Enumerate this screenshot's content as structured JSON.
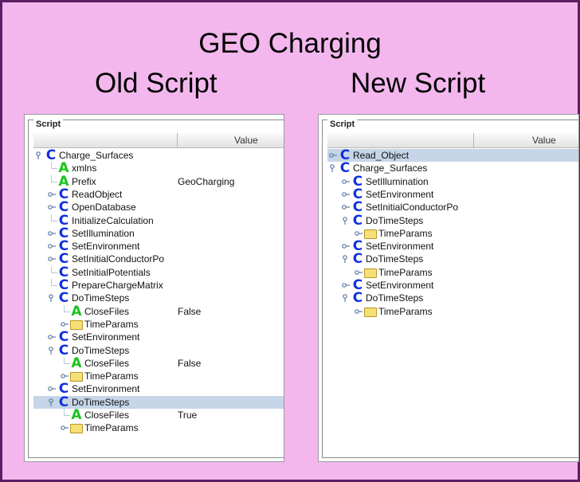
{
  "slide": {
    "title": "GEO Charging",
    "left_heading": "Old Script",
    "right_heading": "New Script"
  },
  "colors": {
    "slide_background": "#f3b7ee",
    "slide_border": "#5a1f63",
    "class_icon": "#1131e0",
    "attribute_icon": "#18c51a",
    "selected_row": "#c6d6e8"
  },
  "old_script": {
    "frame_label": "Script",
    "value_header": "Value",
    "rows": [
      {
        "level": 0,
        "toggle": "expanded",
        "icon": "class-icon",
        "label": "Charge_Surfaces",
        "value": ""
      },
      {
        "level": 1,
        "toggle": "none",
        "icon": "attribute-icon",
        "label": "xmlns",
        "value": ""
      },
      {
        "level": 1,
        "toggle": "none",
        "icon": "attribute-icon",
        "label": "Prefix",
        "value": "GeoCharging"
      },
      {
        "level": 1,
        "toggle": "collapsed",
        "icon": "class-icon",
        "label": "ReadObject",
        "value": ""
      },
      {
        "level": 1,
        "toggle": "collapsed",
        "icon": "class-icon",
        "label": "OpenDatabase",
        "value": ""
      },
      {
        "level": 1,
        "toggle": "none",
        "icon": "class-icon",
        "label": "InitializeCalculation",
        "value": ""
      },
      {
        "level": 1,
        "toggle": "collapsed",
        "icon": "class-icon",
        "label": "SetIllumination",
        "value": ""
      },
      {
        "level": 1,
        "toggle": "collapsed",
        "icon": "class-icon",
        "label": "SetEnvironment",
        "value": ""
      },
      {
        "level": 1,
        "toggle": "collapsed",
        "icon": "class-icon",
        "label": "SetInitialConductorPo",
        "value": ""
      },
      {
        "level": 1,
        "toggle": "none",
        "icon": "class-icon",
        "label": "SetInitialPotentials",
        "value": ""
      },
      {
        "level": 1,
        "toggle": "none",
        "icon": "class-icon",
        "label": "PrepareChargeMatrix",
        "value": ""
      },
      {
        "level": 1,
        "toggle": "expanded",
        "icon": "class-icon",
        "label": "DoTimeSteps",
        "value": ""
      },
      {
        "level": 2,
        "toggle": "none",
        "icon": "attribute-icon",
        "label": "CloseFiles",
        "value": "False"
      },
      {
        "level": 2,
        "toggle": "collapsed",
        "icon": "folder-icon",
        "label": "TimeParams",
        "value": ""
      },
      {
        "level": 1,
        "toggle": "collapsed",
        "icon": "class-icon",
        "label": "SetEnvironment",
        "value": ""
      },
      {
        "level": 1,
        "toggle": "expanded",
        "icon": "class-icon",
        "label": "DoTimeSteps",
        "value": ""
      },
      {
        "level": 2,
        "toggle": "none",
        "icon": "attribute-icon",
        "label": "CloseFiles",
        "value": "False"
      },
      {
        "level": 2,
        "toggle": "collapsed",
        "icon": "folder-icon",
        "label": "TimeParams",
        "value": ""
      },
      {
        "level": 1,
        "toggle": "collapsed",
        "icon": "class-icon",
        "label": "SetEnvironment",
        "value": ""
      },
      {
        "level": 1,
        "toggle": "expanded",
        "icon": "class-icon",
        "label": "DoTimeSteps",
        "value": "",
        "selected": true
      },
      {
        "level": 2,
        "toggle": "none",
        "icon": "attribute-icon",
        "label": "CloseFiles",
        "value": "True"
      },
      {
        "level": 2,
        "toggle": "collapsed",
        "icon": "folder-icon",
        "label": "TimeParams",
        "value": ""
      }
    ]
  },
  "new_script": {
    "frame_label": "Script",
    "value_header": "Value",
    "rows": [
      {
        "level": 0,
        "toggle": "collapsed",
        "icon": "class-icon",
        "label": "Read_Object",
        "value": "",
        "selected": true
      },
      {
        "level": 0,
        "toggle": "expanded",
        "icon": "class-icon",
        "label": "Charge_Surfaces",
        "value": ""
      },
      {
        "level": 1,
        "toggle": "collapsed",
        "icon": "class-icon",
        "label": "SetIllumination",
        "value": ""
      },
      {
        "level": 1,
        "toggle": "collapsed",
        "icon": "class-icon",
        "label": "SetEnvironment",
        "value": ""
      },
      {
        "level": 1,
        "toggle": "collapsed",
        "icon": "class-icon",
        "label": "SetInitialConductorPo",
        "value": ""
      },
      {
        "level": 1,
        "toggle": "expanded",
        "icon": "class-icon",
        "label": "DoTimeSteps",
        "value": ""
      },
      {
        "level": 2,
        "toggle": "collapsed",
        "icon": "folder-icon",
        "label": "TimeParams",
        "value": ""
      },
      {
        "level": 1,
        "toggle": "collapsed",
        "icon": "class-icon",
        "label": "SetEnvironment",
        "value": ""
      },
      {
        "level": 1,
        "toggle": "expanded",
        "icon": "class-icon",
        "label": "DoTimeSteps",
        "value": ""
      },
      {
        "level": 2,
        "toggle": "collapsed",
        "icon": "folder-icon",
        "label": "TimeParams",
        "value": ""
      },
      {
        "level": 1,
        "toggle": "collapsed",
        "icon": "class-icon",
        "label": "SetEnvironment",
        "value": ""
      },
      {
        "level": 1,
        "toggle": "expanded",
        "icon": "class-icon",
        "label": "DoTimeSteps",
        "value": ""
      },
      {
        "level": 2,
        "toggle": "collapsed",
        "icon": "folder-icon",
        "label": "TimeParams",
        "value": ""
      }
    ]
  }
}
